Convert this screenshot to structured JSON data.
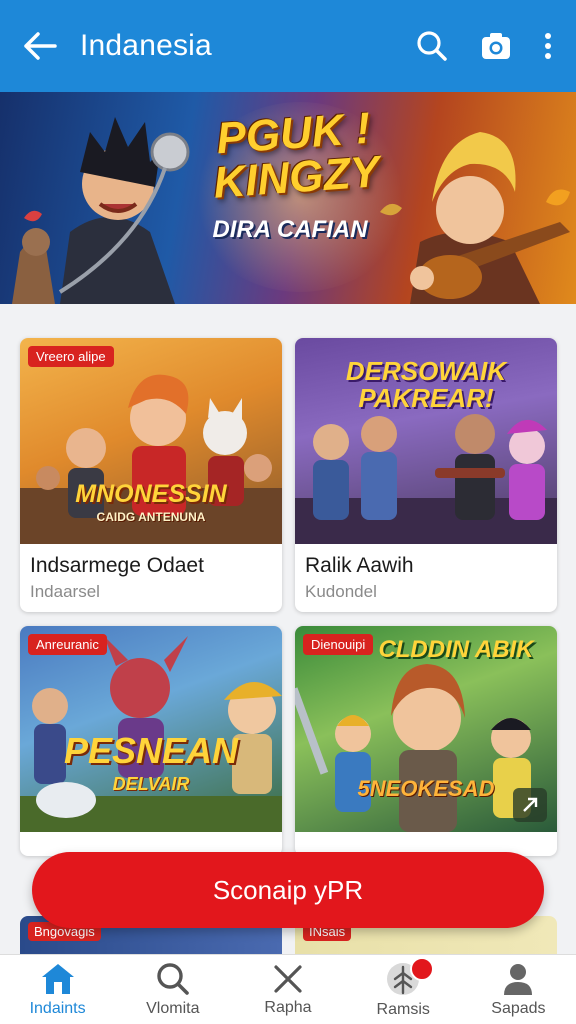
{
  "header": {
    "title": "Indanesia",
    "back_icon": "arrow-left-icon",
    "search_icon": "search-icon",
    "camera_icon": "camera-icon",
    "more_icon": "more-vertical-icon",
    "color": "#1e88d8"
  },
  "banner": {
    "headline": "PGUK ! KINGZY",
    "subline": "DIRA CAFIAN"
  },
  "cards": [
    {
      "tag": "Vreero alipe",
      "art_title": "MNONESSIN",
      "art_sub": "CAIDG ANTENUNA",
      "name": "Indsarmege Odaet",
      "sub": "Indaarsel"
    },
    {
      "art_title": "DERSOWAIK PAKREAR!",
      "name": "Ralik Aawih",
      "sub": "Kudondel"
    },
    {
      "tag": "Anreuranic",
      "art_title": "PESNEAN",
      "art_sub": "DELVAIR"
    },
    {
      "tag": "Dienouipi",
      "art_title": "CLDDIN ABIK",
      "art_sub": "5NEOKESAD"
    }
  ],
  "peek_tags": [
    "Bngovagis",
    "INsais"
  ],
  "cta": {
    "label": "Sconaip yPR",
    "color": "#e2171c"
  },
  "nav": [
    {
      "label": "Indaints",
      "icon": "home-icon",
      "active": true
    },
    {
      "label": "Vlomita",
      "icon": "search-icon"
    },
    {
      "label": "Rapha",
      "icon": "close-icon"
    },
    {
      "label": "Ramsis",
      "icon": "leaf-icon",
      "badge": true
    },
    {
      "label": "Sapads",
      "icon": "user-icon"
    }
  ]
}
